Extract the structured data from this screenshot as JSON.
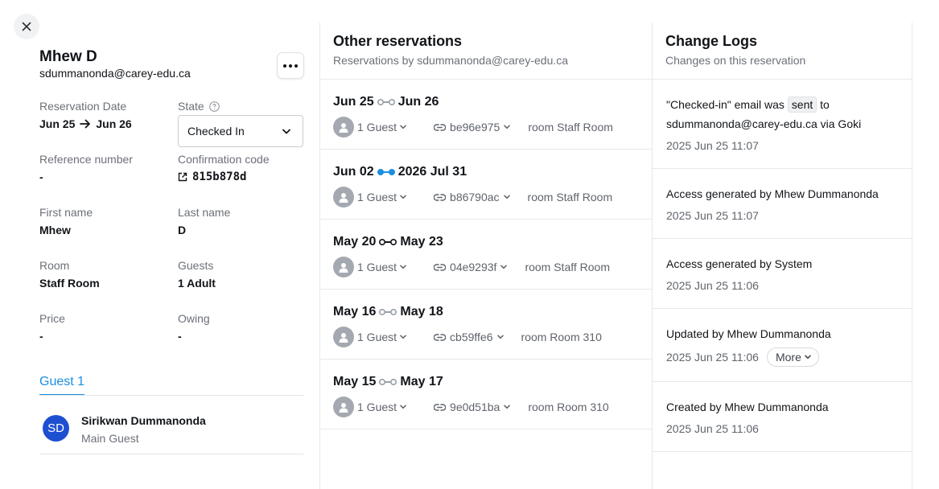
{
  "guest_panel": {
    "name": "Mhew D",
    "email": "sdummanonda@carey-edu.ca",
    "reservation_date_label": "Reservation Date",
    "date_from": "Jun 25",
    "date_to": "Jun 26",
    "state_label": "State",
    "state_value": "Checked In",
    "reference_label": "Reference number",
    "reference_value": "-",
    "confirmation_label": "Confirmation code",
    "confirmation_value": "815b878d",
    "first_name_label": "First name",
    "first_name_value": "Mhew",
    "last_name_label": "Last name",
    "last_name_value": "D",
    "room_label": "Room",
    "room_value": "Staff Room",
    "guests_label": "Guests",
    "guests_value": "1 Adult",
    "price_label": "Price",
    "price_value": "-",
    "owing_label": "Owing",
    "owing_value": "-",
    "guest_tab": "Guest 1",
    "guest_initials": "SD",
    "guest_full_name": "Sirikwan Dummanonda",
    "guest_role": "Main Guest"
  },
  "other_reservations": {
    "title": "Other reservations",
    "subtitle": "Reservations by sdummanonda@carey-edu.ca",
    "items": [
      {
        "from": "Jun 25",
        "to": "Jun 26",
        "guests": "1 Guest",
        "code": "be96e975",
        "room": "room Staff Room",
        "active": false
      },
      {
        "from": "Jun 02",
        "to": "2026 Jul 31",
        "guests": "1 Guest",
        "code": "b86790ac",
        "room": "room Staff Room",
        "active": true
      },
      {
        "from": "May 20",
        "to": "May 23",
        "guests": "1 Guest",
        "code": "04e9293f",
        "room": "room Staff Room",
        "active": false,
        "dark": true
      },
      {
        "from": "May 16",
        "to": "May 18",
        "guests": "1 Guest",
        "code": "cb59ffe6",
        "room": "room Room 310",
        "active": false
      },
      {
        "from": "May 15",
        "to": "May 17",
        "guests": "1 Guest",
        "code": "9e0d51ba",
        "room": "room Room 310",
        "active": false
      }
    ]
  },
  "change_logs": {
    "title": "Change Logs",
    "subtitle": "Changes on this reservation",
    "first_log": {
      "prefix": "\"Checked-in\" email was",
      "chip": "sent",
      "suffix": "to sdummanonda@carey-edu.ca via Goki",
      "time": "2025 Jun 25 11:07"
    },
    "items": [
      {
        "text": "Access generated by Mhew Dummanonda",
        "time": "2025 Jun 25 11:07"
      },
      {
        "text": "Access generated by System",
        "time": "2025 Jun 25 11:06"
      },
      {
        "text": "Updated by Mhew Dummanonda",
        "time": "2025 Jun 25 11:06",
        "more": "More"
      },
      {
        "text": "Created by Mhew Dummanonda",
        "time": "2025 Jun 25 11:06"
      }
    ]
  },
  "colors": {
    "accent": "#1a8fe0",
    "avatar": "#1f4fd1"
  }
}
